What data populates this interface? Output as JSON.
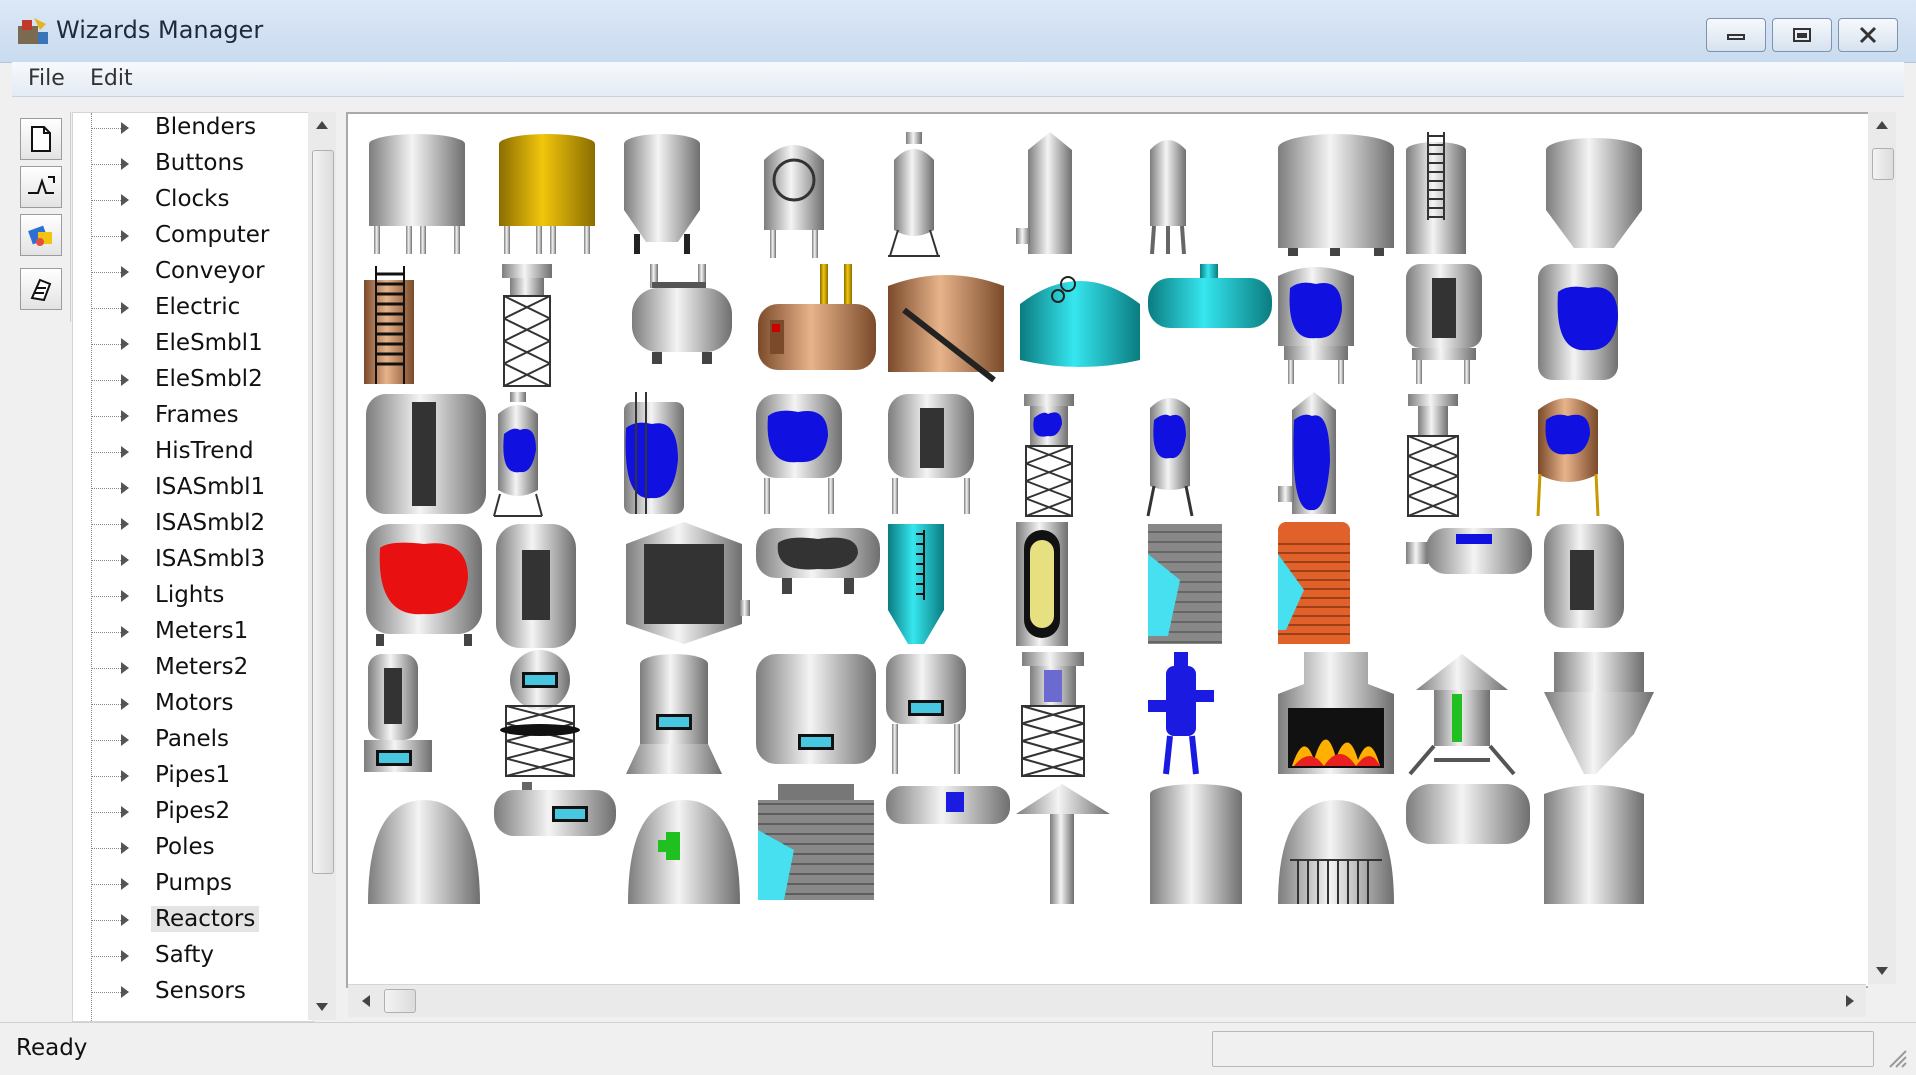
{
  "window": {
    "title": "Wizards Manager"
  },
  "menu": [
    "File",
    "Edit"
  ],
  "toolbar": [
    {
      "name": "new-page-icon"
    },
    {
      "name": "link-icon"
    },
    {
      "name": "paint-icon"
    },
    {
      "name": "wizard-icon"
    }
  ],
  "tree": {
    "items": [
      "Blenders",
      "Buttons",
      "Clocks",
      "Computer",
      "Conveyor",
      "Electric",
      "EleSmbl1",
      "EleSmbl2",
      "Frames",
      "HisTrend",
      "ISASmbl1",
      "ISASmbl2",
      "ISASmbl3",
      "Lights",
      "Meters1",
      "Meters2",
      "Motors",
      "Panels",
      "Pipes1",
      "Pipes2",
      "Poles",
      "Pumps",
      "Reactors",
      "Safty",
      "Sensors"
    ],
    "selected": "Reactors"
  },
  "gallery": {
    "category": "Reactors",
    "rows": [
      [
        "tank-legs",
        "tank-legs-gold",
        "tank-cone",
        "tank-manway",
        "vessel-small",
        "tank-tall",
        "tank-tall-legs",
        "tank-large",
        "tank-ladder",
        "tank-cone-large"
      ],
      [
        "tank-ladder-gold",
        "tower-lattice",
        "drum-horizontal",
        "boiler-copper",
        "tank-copper",
        "tank-cyan-dome",
        "drum-cyan",
        "tank-level-blue",
        "tank-window-legs",
        "tank-level-blue-cut"
      ],
      [
        "tank-window",
        "vessel-level-blue",
        "tank-ladder-blue",
        "tank-level-blue-legs",
        "tank-window-legs2",
        "tower-level-blue",
        "vessel-level-blue2",
        "tank-level-blue-tall",
        "tower-lattice2",
        "tank-level-blue-gold"
      ],
      [
        "tank-level-red",
        "tank-window-round",
        "hopper-window",
        "drum-horizontal-dark",
        "tank-cyan-gauge",
        "tube-yellow",
        "tower-brick-cyan",
        "tower-brick-red",
        "drum-horizontal-small",
        "tank-window-partial"
      ],
      [
        "tank-panel",
        "sphere-tower",
        "tank-panel-base",
        "tank-panel-large",
        "tank-panel-legs",
        "tower-water",
        "pump-blue",
        "furnace",
        "silo-green",
        "hopper-partial"
      ],
      [
        "dome-gray",
        "drum-panel",
        "dome-green",
        "brick-cyan",
        "drum-blue-panel",
        "roof-cone",
        "tank-flat",
        "dome-grid",
        "drum-horizontal-big",
        "tank-partial"
      ]
    ]
  },
  "status": {
    "text": "Ready"
  }
}
